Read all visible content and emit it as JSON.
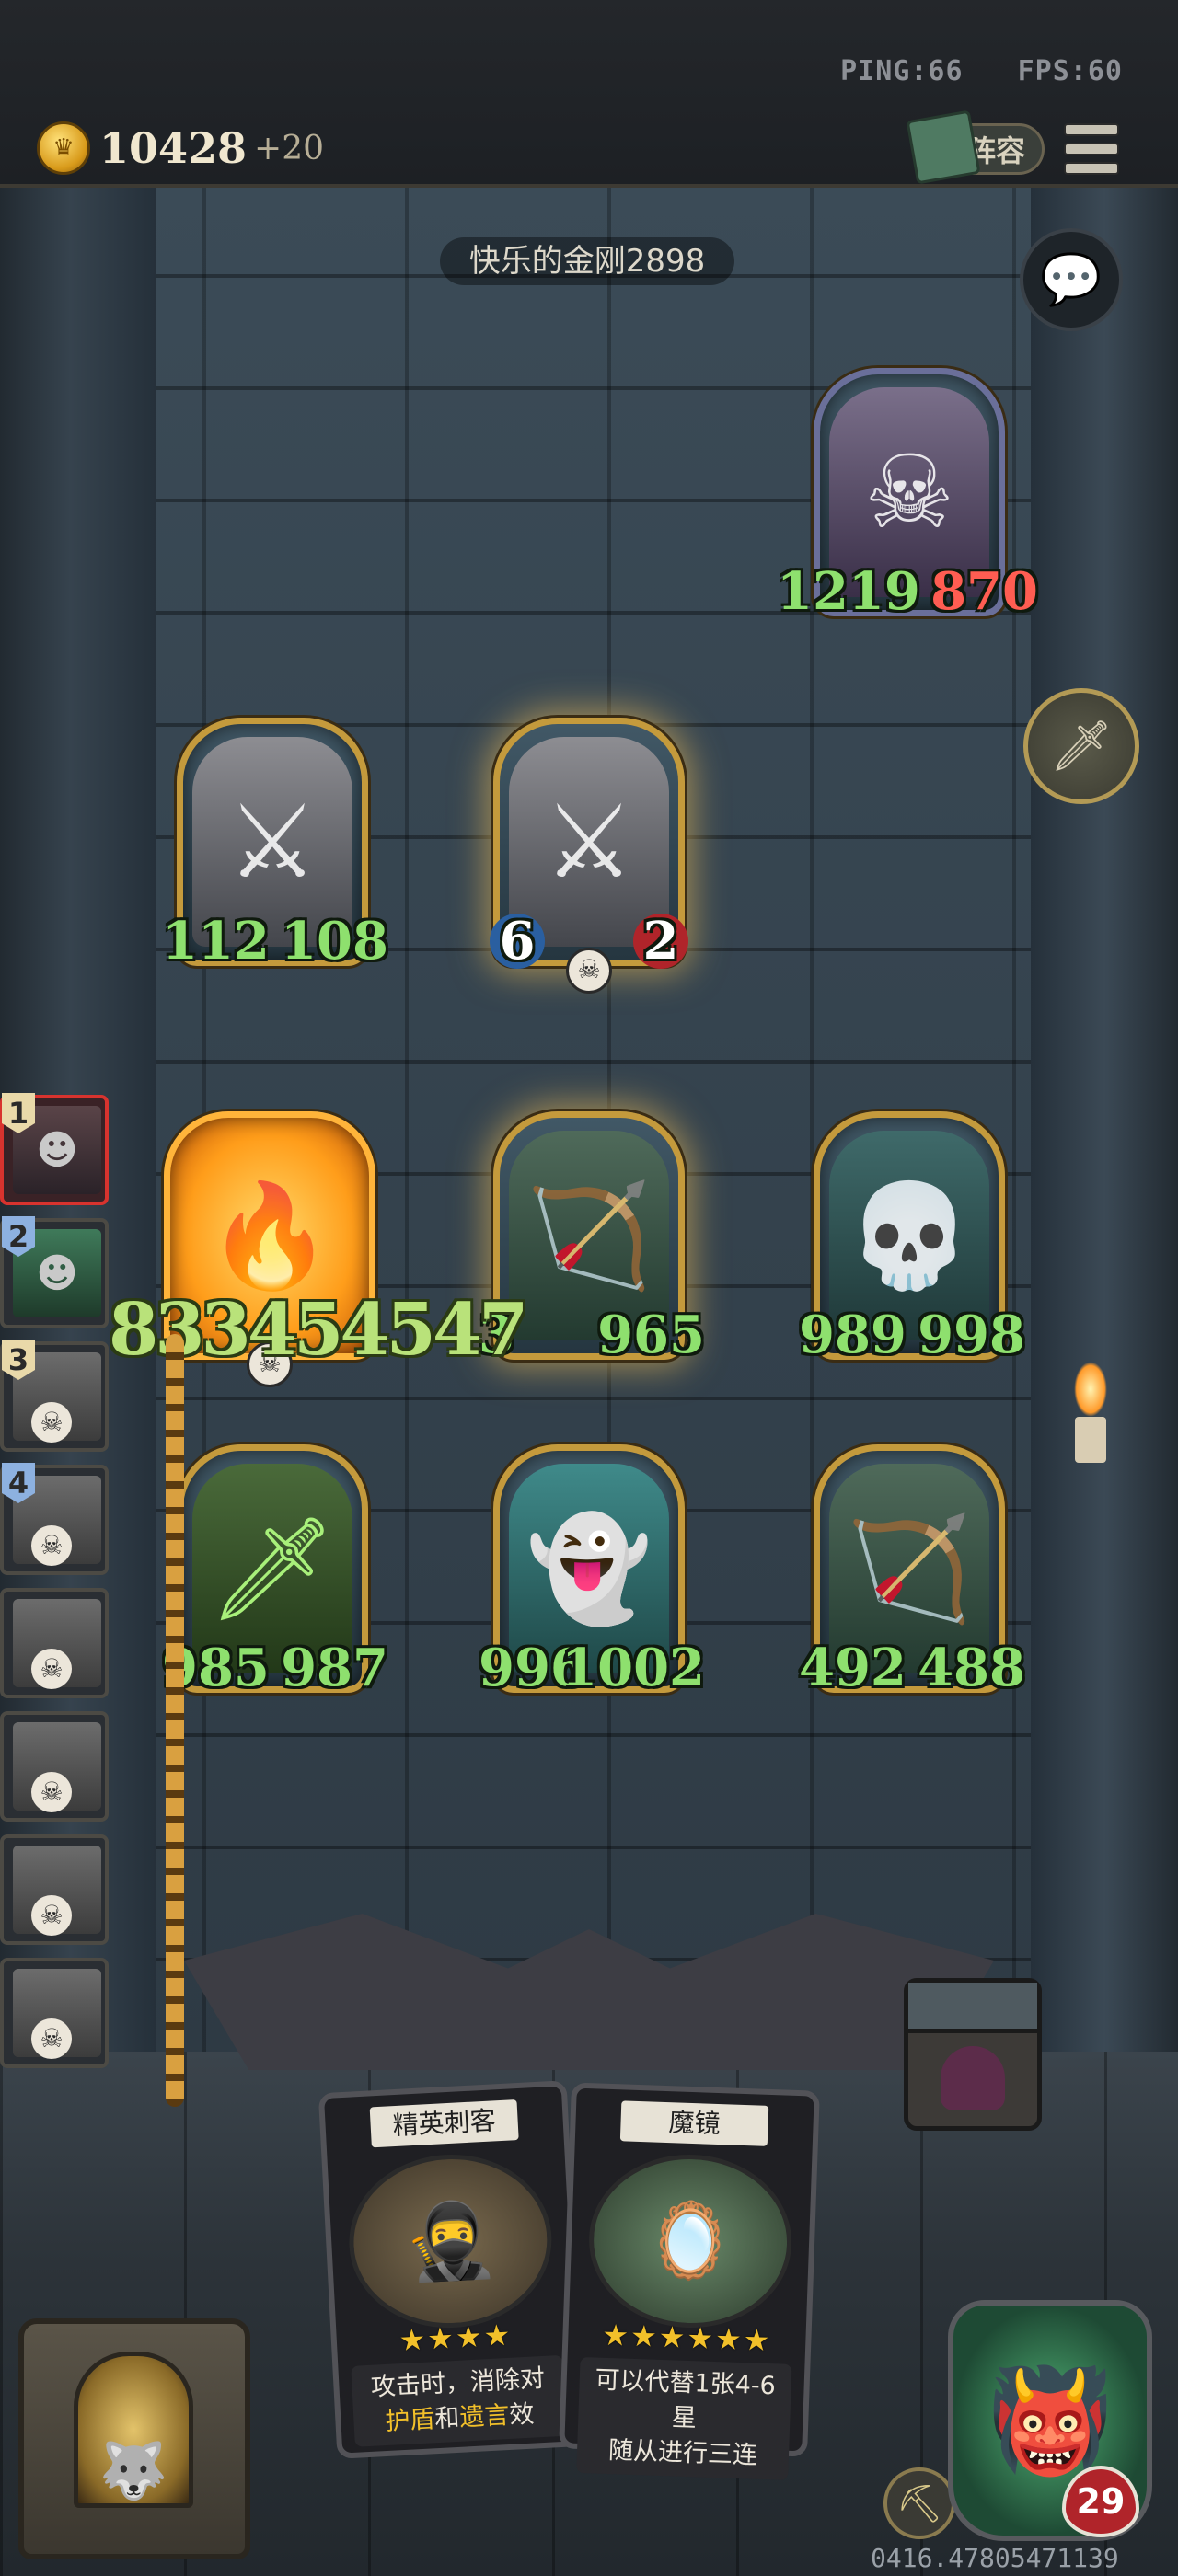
{
  "hud": {
    "ping": "PING:66",
    "fps": "FPS:60",
    "gold": "10428",
    "gold_bonus": "+20",
    "lineup_label": "阵容"
  },
  "opponent": {
    "name": "快乐的金刚2898",
    "hero": {
      "attack": "1219",
      "health": "870"
    }
  },
  "enemy_board": [
    {
      "attack": "112",
      "health": "108"
    },
    {
      "attack": "6",
      "health": "2"
    }
  ],
  "player_board": {
    "row1": [
      {
        "attack": "",
        "health": ""
      },
      {
        "attack": "3",
        "health": "965"
      },
      {
        "attack": "989",
        "health": "998"
      }
    ],
    "row2": [
      {
        "attack": "985",
        "health": "987"
      },
      {
        "attack": "996",
        "health": "1002"
      },
      {
        "attack": "492",
        "health": "488"
      }
    ]
  },
  "damage_float": "833454547",
  "ranking": [
    {
      "rank": "1"
    },
    {
      "rank": "2"
    },
    {
      "rank": "3"
    },
    {
      "rank": "4"
    },
    {
      "rank": ""
    },
    {
      "rank": ""
    },
    {
      "rank": ""
    },
    {
      "rank": ""
    }
  ],
  "hand": [
    {
      "name": "精英刺客",
      "stars": "★★★★",
      "desc_a": "攻击时，消除对",
      "desc_b_hl1": "护盾",
      "desc_b_mid": "和",
      "desc_b_hl2": "遗言",
      "desc_b_end": "效"
    },
    {
      "name": "魔镜",
      "stars": "★★★★★★",
      "desc_a": "可以代替1张4-6星",
      "desc_b": "随从进行三连"
    }
  ],
  "player_hero": {
    "health": "29"
  },
  "seed": "0416.47805471139",
  "colors": {
    "gold_frame": "#c49a3c",
    "stat_green": "#8ee06e",
    "stat_red": "#ff5d52",
    "active_rank": "#d8332e"
  }
}
